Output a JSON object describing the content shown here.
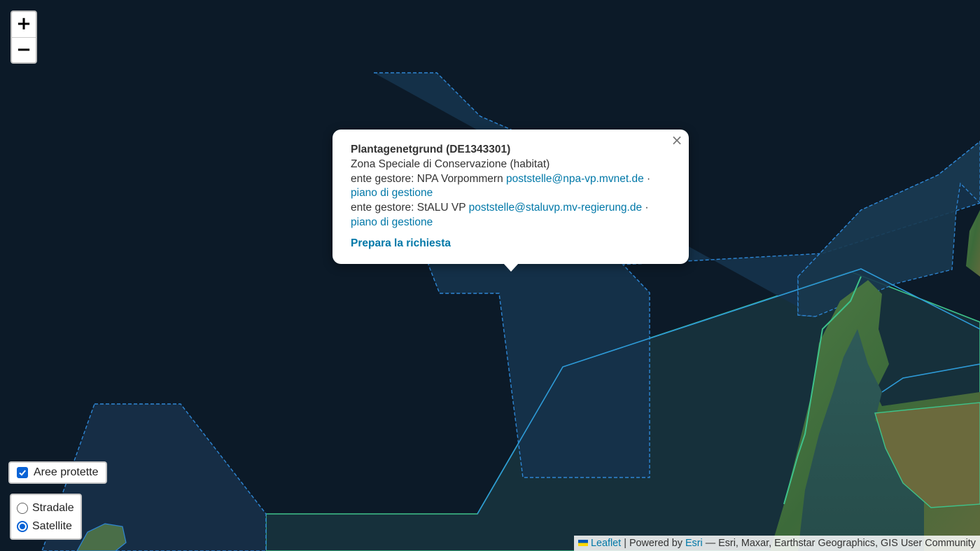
{
  "zoom": {
    "in_label": "+",
    "out_label": "−"
  },
  "popup": {
    "title": "Plantagenetgrund (DE1343301)",
    "type": "Zona Speciale di Conservazione (habitat)",
    "managers": [
      {
        "prefix": "ente gestore: NPA Vorpommern",
        "email": "poststelle@npa-vp.mvnet.de",
        "separator": "·",
        "plan": "piano di gestione"
      },
      {
        "prefix": "ente gestore: StALU VP",
        "email": "poststelle@staluvp.mv-regierung.de",
        "separator": "·",
        "plan": "piano di gestione"
      }
    ],
    "cta": "Prepara la richiesta",
    "close": "×"
  },
  "overlays": {
    "protected_areas": {
      "label": "Aree protette",
      "checked": true
    }
  },
  "basemaps": {
    "options": [
      {
        "label": "Stradale",
        "selected": false
      },
      {
        "label": "Satellite",
        "selected": true
      }
    ]
  },
  "attribution": {
    "leaflet": "Leaflet",
    "sep1": "|",
    "powered": "Powered by",
    "esri": "Esri",
    "rest": "— Esri, Maxar, Earthstar Geographics, GIS User Community"
  },
  "colors": {
    "water": "#0c1a28",
    "protected_fill": "#1a3a55",
    "dashed_border": "#2e86d4",
    "green_border": "#3ec28a",
    "land": "#3d6b40",
    "link": "#0078a8"
  }
}
